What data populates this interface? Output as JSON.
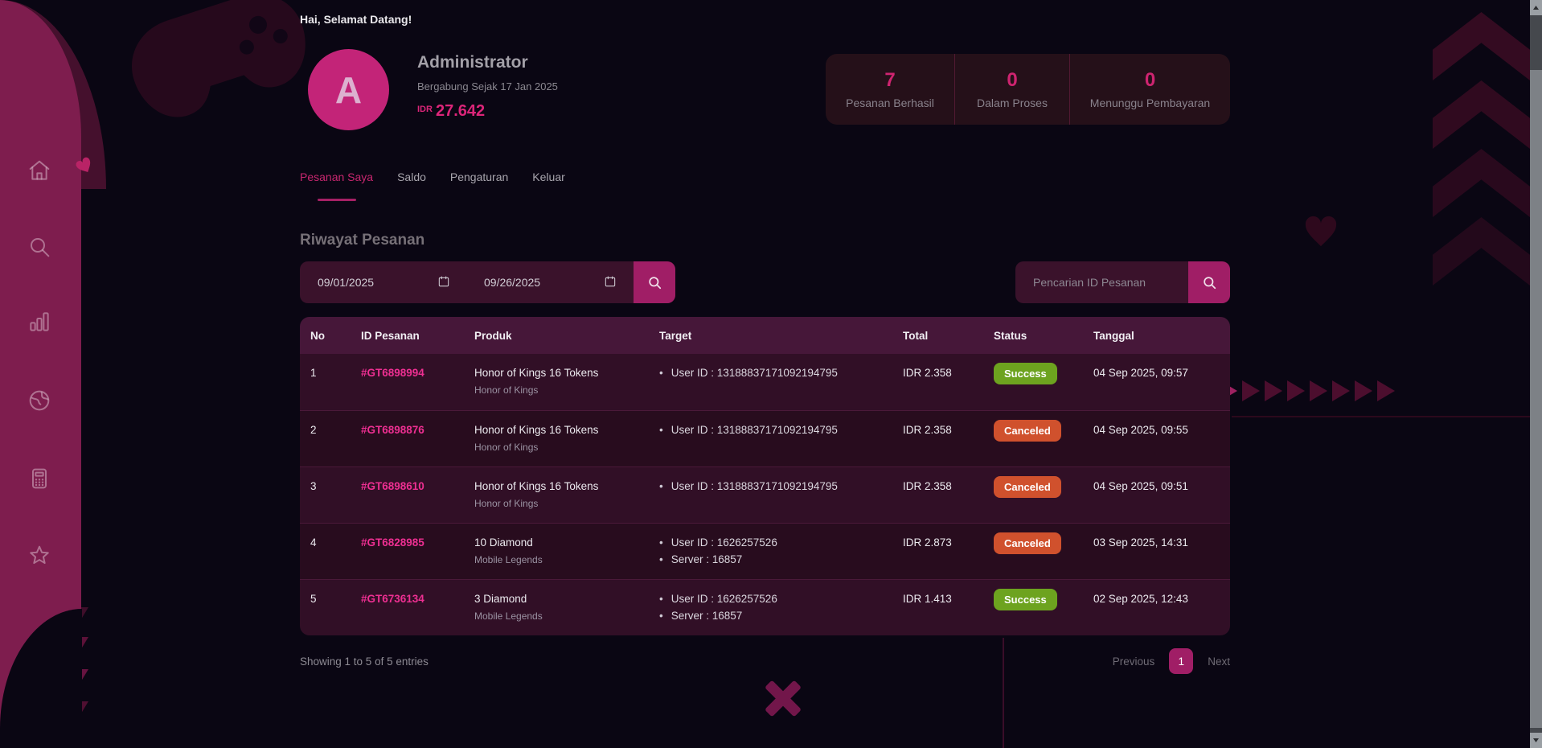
{
  "header": {
    "welcome": "Hai, Selamat Datang!",
    "avatar_letter": "A",
    "username": "Administrator",
    "joined": "Bergabung Sejak 17 Jan 2025",
    "currency": "IDR",
    "balance": "27.642"
  },
  "stats": [
    {
      "value": "7",
      "label": "Pesanan Berhasil"
    },
    {
      "value": "0",
      "label": "Dalam Proses"
    },
    {
      "value": "0",
      "label": "Menunggu Pembayaran"
    }
  ],
  "tabs": [
    {
      "label": "Pesanan Saya",
      "active": true
    },
    {
      "label": "Saldo",
      "active": false
    },
    {
      "label": "Pengaturan",
      "active": false
    },
    {
      "label": "Keluar",
      "active": false
    }
  ],
  "section_title": "Riwayat Pesanan",
  "filters": {
    "date_from": "09/01/2025",
    "date_to": "09/26/2025",
    "search_placeholder": "Pencarian ID Pesanan"
  },
  "table": {
    "headers": [
      "No",
      "ID Pesanan",
      "Produk",
      "Target",
      "Total",
      "Status",
      "Tanggal"
    ],
    "rows": [
      {
        "no": "1",
        "id": "#GT6898994",
        "product": "Honor of Kings 16 Tokens",
        "game": "Honor of Kings",
        "target": [
          "User ID : 13188837171092194795"
        ],
        "total": "IDR 2.358",
        "status": "Success",
        "status_type": "success",
        "date": "04 Sep 2025, 09:57"
      },
      {
        "no": "2",
        "id": "#GT6898876",
        "product": "Honor of Kings 16 Tokens",
        "game": "Honor of Kings",
        "target": [
          "User ID : 13188837171092194795"
        ],
        "total": "IDR 2.358",
        "status": "Canceled",
        "status_type": "canceled",
        "date": "04 Sep 2025, 09:55"
      },
      {
        "no": "3",
        "id": "#GT6898610",
        "product": "Honor of Kings 16 Tokens",
        "game": "Honor of Kings",
        "target": [
          "User ID : 13188837171092194795"
        ],
        "total": "IDR 2.358",
        "status": "Canceled",
        "status_type": "canceled",
        "date": "04 Sep 2025, 09:51"
      },
      {
        "no": "4",
        "id": "#GT6828985",
        "product": "10 Diamond",
        "game": "Mobile Legends",
        "target": [
          "User ID : 1626257526",
          "Server : 16857"
        ],
        "total": "IDR 2.873",
        "status": "Canceled",
        "status_type": "canceled",
        "date": "03 Sep 2025, 14:31"
      },
      {
        "no": "5",
        "id": "#GT6736134",
        "product": "3 Diamond",
        "game": "Mobile Legends",
        "target": [
          "User ID : 1626257526",
          "Server : 16857"
        ],
        "total": "IDR 1.413",
        "status": "Success",
        "status_type": "success",
        "date": "02 Sep 2025, 12:43"
      }
    ]
  },
  "footer": {
    "showing": "Showing 1 to 5 of 5 entries",
    "previous": "Previous",
    "page": "1",
    "next": "Next"
  },
  "icons": {
    "sidebar": [
      "home-icon",
      "search-icon",
      "bar-chart-icon",
      "globe-icon",
      "invoice-icon",
      "star-icon"
    ],
    "filter": [
      "calendar-icon",
      "search-icon"
    ]
  },
  "colors": {
    "background": "#0a0613",
    "sidebar_magenta": "#7e1d4e",
    "accent_pink": "#d6256f",
    "button_magenta": "#a01e66",
    "id_link_pink": "#ee2f92",
    "success_green": "#6da31f",
    "canceled_orange": "#d0512d",
    "table_header": "#461739"
  }
}
